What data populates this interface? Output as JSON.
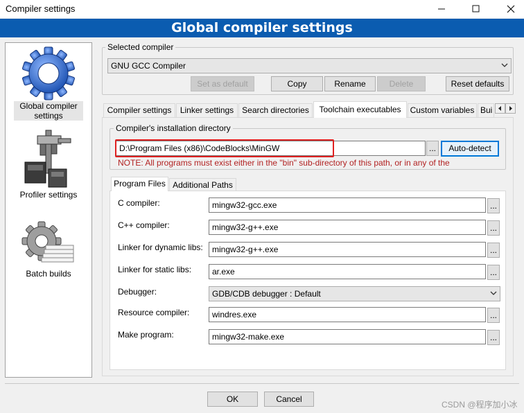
{
  "window": {
    "title": "Compiler settings"
  },
  "header": {
    "title": "Global compiler settings"
  },
  "sidebar": {
    "items": [
      {
        "label_line1": "Global compiler",
        "label_line2": "settings",
        "icon": "gear-icon"
      },
      {
        "label": "Profiler settings",
        "icon": "caliper-icon"
      },
      {
        "label": "Batch builds",
        "icon": "batch-gear-icon"
      }
    ]
  },
  "selected_compiler": {
    "group_label": "Selected compiler",
    "value": "GNU GCC Compiler",
    "buttons": {
      "set_default": "Set as default",
      "copy": "Copy",
      "rename": "Rename",
      "delete": "Delete",
      "reset": "Reset defaults"
    }
  },
  "tabs": {
    "items": [
      "Compiler settings",
      "Linker settings",
      "Search directories",
      "Toolchain executables",
      "Custom variables",
      "Bui"
    ],
    "active": "Toolchain executables"
  },
  "install_dir": {
    "group_label": "Compiler's installation directory",
    "value": "D:\\Program Files (x86)\\CodeBlocks\\MinGW",
    "browse": "...",
    "autodetect": "Auto-detect",
    "note": "NOTE: All programs must exist either in the \"bin\" sub-directory of this path, or in any of the"
  },
  "subtabs": {
    "items": [
      "Program Files",
      "Additional Paths"
    ],
    "active": "Program Files"
  },
  "programs": [
    {
      "label": "C compiler:",
      "value": "mingw32-gcc.exe",
      "type": "text"
    },
    {
      "label": "C++ compiler:",
      "value": "mingw32-g++.exe",
      "type": "text"
    },
    {
      "label": "Linker for dynamic libs:",
      "value": "mingw32-g++.exe",
      "type": "text"
    },
    {
      "label": "Linker for static libs:",
      "value": "ar.exe",
      "type": "text"
    },
    {
      "label": "Debugger:",
      "value": "GDB/CDB debugger : Default",
      "type": "select"
    },
    {
      "label": "Resource compiler:",
      "value": "windres.exe",
      "type": "text"
    },
    {
      "label": "Make program:",
      "value": "mingw32-make.exe",
      "type": "text"
    }
  ],
  "browse_label": "...",
  "footer": {
    "ok": "OK",
    "cancel": "Cancel"
  },
  "watermark": "CSDN @程序加小冰",
  "colors": {
    "banner": "#0b5cb0",
    "note": "#b22222",
    "highlight": "#e02020",
    "focus": "#0078d7"
  }
}
